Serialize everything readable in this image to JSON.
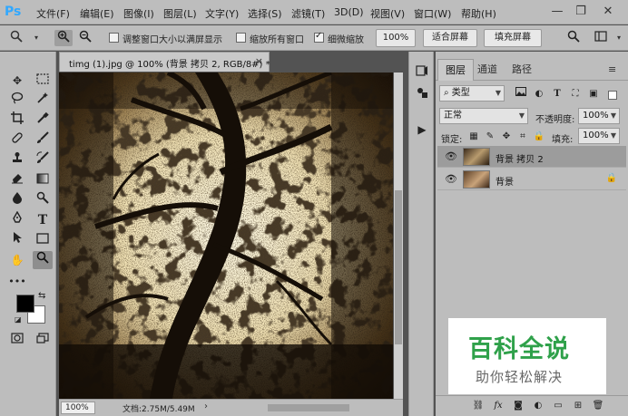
{
  "app": {
    "logo": "Ps"
  },
  "menu": [
    "文件(F)",
    "编辑(E)",
    "图像(I)",
    "图层(L)",
    "文字(Y)",
    "选择(S)",
    "滤镜(T)",
    "3D(D)",
    "视图(V)",
    "窗口(W)",
    "帮助(H)"
  ],
  "window_controls": {
    "minimize": "—",
    "restore": "❐",
    "close": "✕"
  },
  "options": {
    "resize_window_label": "调整窗口大小以满屏显示",
    "resize_window_checked": false,
    "zoom_all_label": "缩放所有窗口",
    "zoom_all_checked": false,
    "scrubby_label": "细微缩放",
    "scrubby_checked": true,
    "btn_100": "100%",
    "btn_fit": "适合屏幕",
    "btn_fill": "填充屏幕"
  },
  "document": {
    "tab_title": "timg (1).jpg @ 100% (背景 拷贝 2, RGB/8#) *",
    "close": "×",
    "zoom": "100%",
    "doc_size": "文档:2.75M/5.49M",
    "status_arrow": "›"
  },
  "panel": {
    "tabs": [
      "图层",
      "通道",
      "路径"
    ],
    "active_tab": 0,
    "filter_kind": "类型",
    "blend_mode": "正常",
    "opacity_label": "不透明度:",
    "opacity_value": "100%",
    "lock_label": "锁定:",
    "fill_label": "填充:",
    "fill_value": "100%",
    "menu_icon": "≡"
  },
  "layers": [
    {
      "name": "背景 拷贝 2",
      "visible": true,
      "selected": true,
      "locked": false
    },
    {
      "name": "背景",
      "visible": true,
      "selected": false,
      "locked": true
    }
  ],
  "watermark": {
    "title": "百科全说",
    "subtitle": "助你轻松解决",
    "title_color": "#2fa14a"
  },
  "colors": {
    "accent": "#31a8ff",
    "chrome": "#bdbdbd",
    "foreground_swatch": "#000000",
    "background_swatch": "#ffffff"
  }
}
